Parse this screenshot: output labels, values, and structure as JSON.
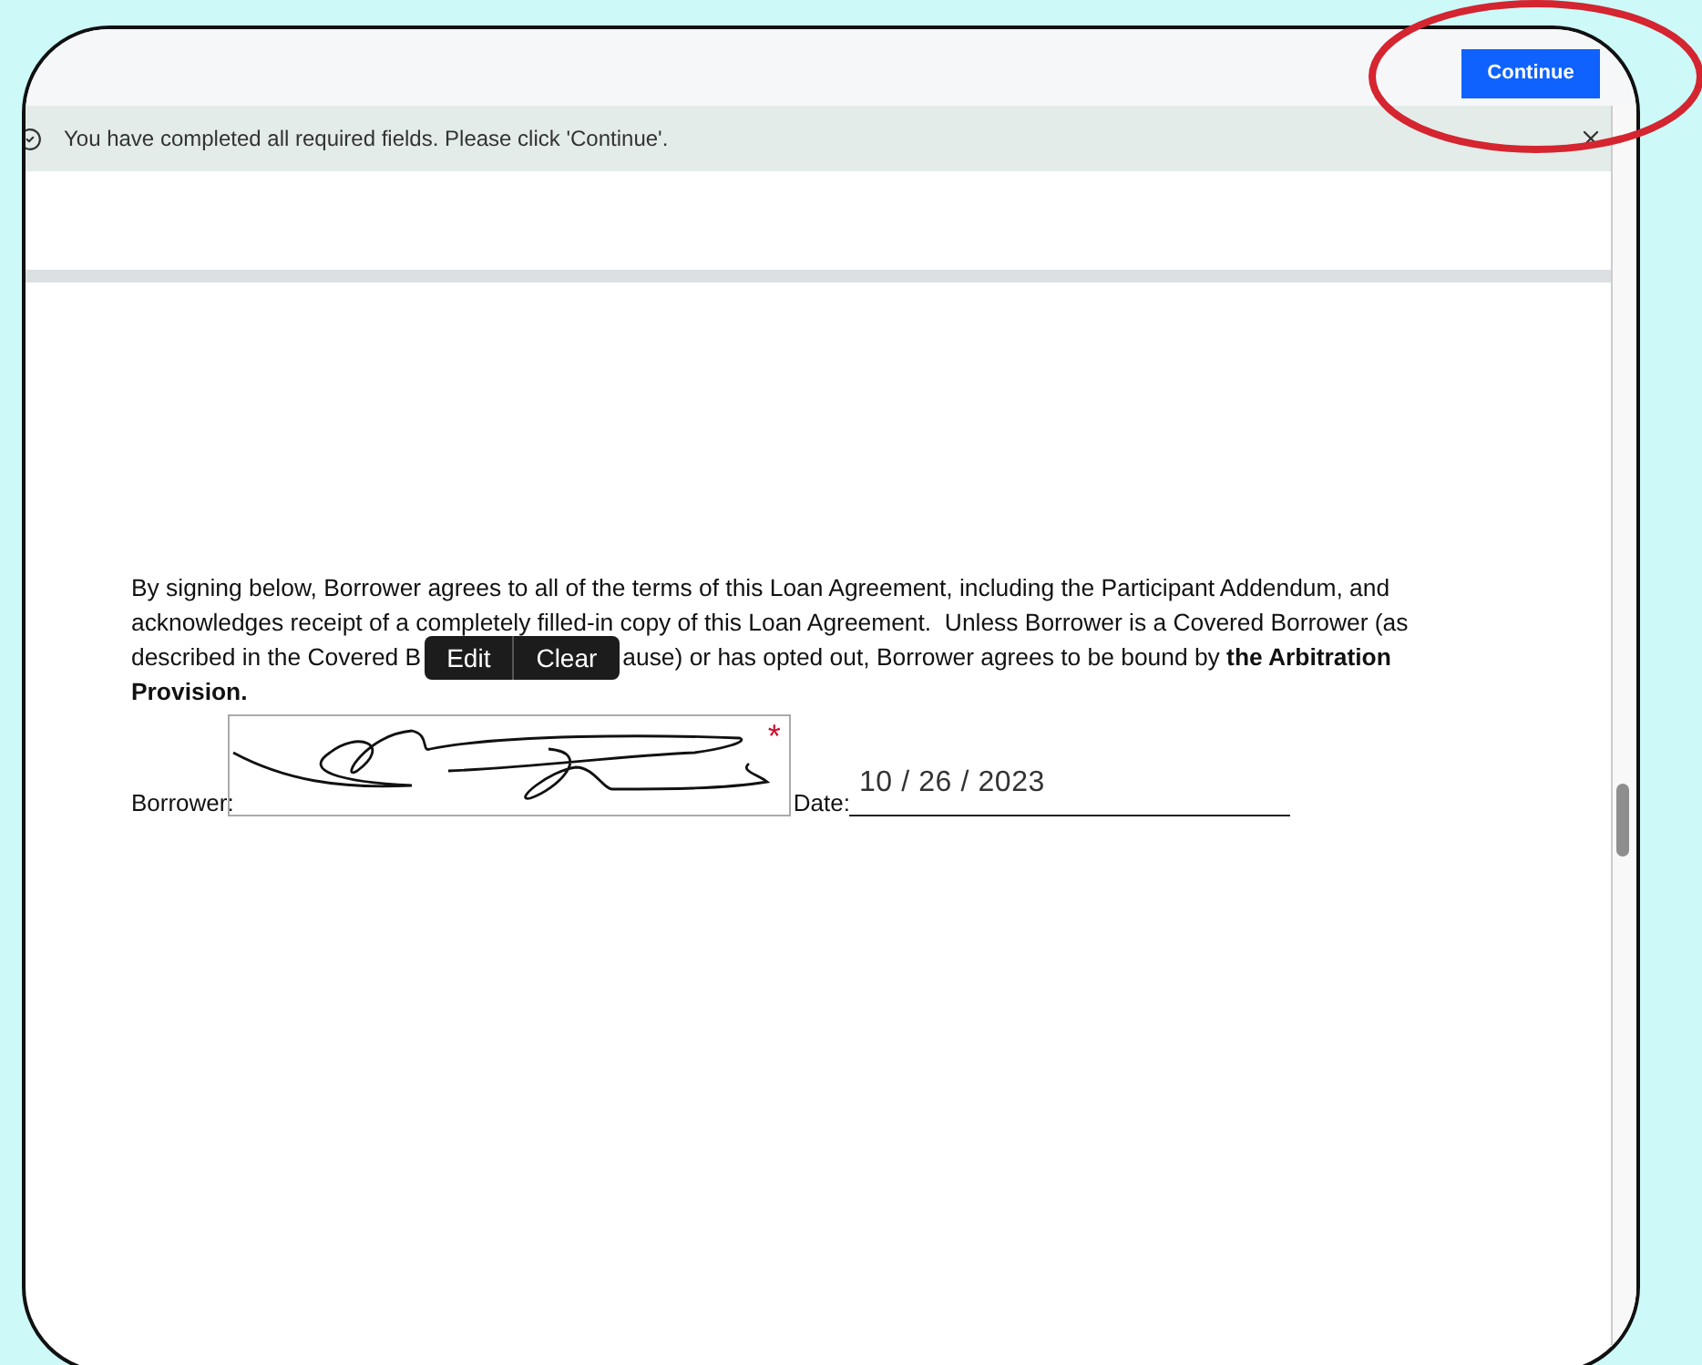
{
  "header": {
    "button": "Continue"
  },
  "banner": {
    "message": "You have completed all required fields. Please click 'Continue'."
  },
  "agreement": {
    "lines_before": [
      "By signing below, Borrower agrees to all of the terms of this Loan Agreement, including the Participant Addendum, and",
      "acknowledges receipt of a completely filled-in copy of this Loan Agreement.  Unless Borrower is a Covered Borrower (as",
      "described in the Covered B"
    ],
    "toolbar": [
      "Edit",
      "Clear"
    ],
    "lines_after": [
      "ause) or has opted out, Borrower agrees to be bound by **the Arbitration**",
      "**Provision.**"
    ]
  },
  "signature": {
    "label": "Borrower:",
    "required_mark": "*",
    "date_label": "Date:",
    "date_value": "10 / 26 / 2023"
  }
}
